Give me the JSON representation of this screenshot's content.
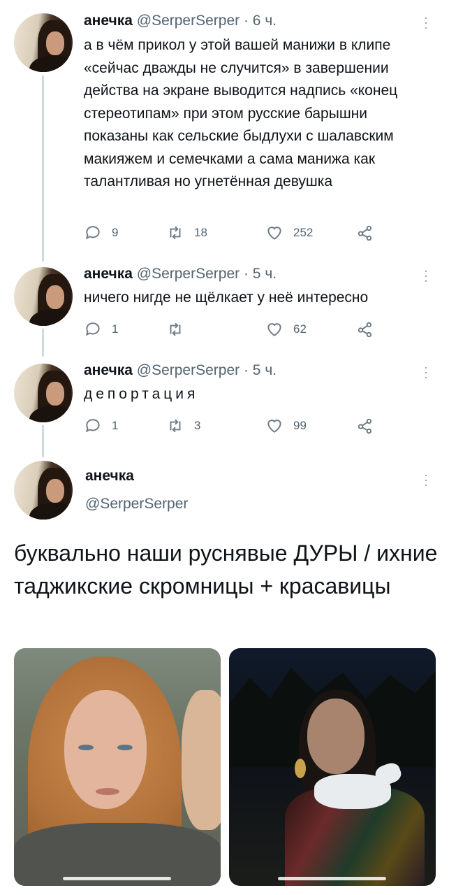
{
  "thread": [
    {
      "author": {
        "name": "анечка",
        "handle": "@SerperSerper",
        "time": "· 6 ч."
      },
      "text": "а в чём прикол у этой вашей манижи в клипе «сейчас дважды не случится» в завершении действа на экране выводится надпись «конец стереотипам» при этом русские барышни показаны как сельские быдлухи с шалавским макияжем и семечками а сама манижа как талантливая но угнетённая девушка",
      "replies": "9",
      "retweets": "18",
      "likes": "252"
    },
    {
      "author": {
        "name": "анечка",
        "handle": "@SerperSerper",
        "time": "· 5 ч."
      },
      "text": "ничего нигде не щёлкает у неё интересно",
      "replies": "1",
      "retweets": "",
      "likes": "62"
    },
    {
      "author": {
        "name": "анечка",
        "handle": "@SerperSerper",
        "time": "· 5 ч."
      },
      "text": "депортация",
      "replies": "1",
      "retweets": "3",
      "likes": "99"
    }
  ],
  "main_tweet": {
    "author": {
      "name": "анечка",
      "handle": "@SerperSerper"
    },
    "text": "буквально наши руснявые ДУРЫ / ихние таджикские скромницы + красавицы"
  },
  "icons": {
    "reply": "reply-icon",
    "retweet": "retweet-icon",
    "like": "like-icon",
    "share": "share-icon",
    "more": "more-icon"
  },
  "colors": {
    "text": "#0f1419",
    "secondary": "#536471",
    "thread_line": "#cfd9de"
  }
}
